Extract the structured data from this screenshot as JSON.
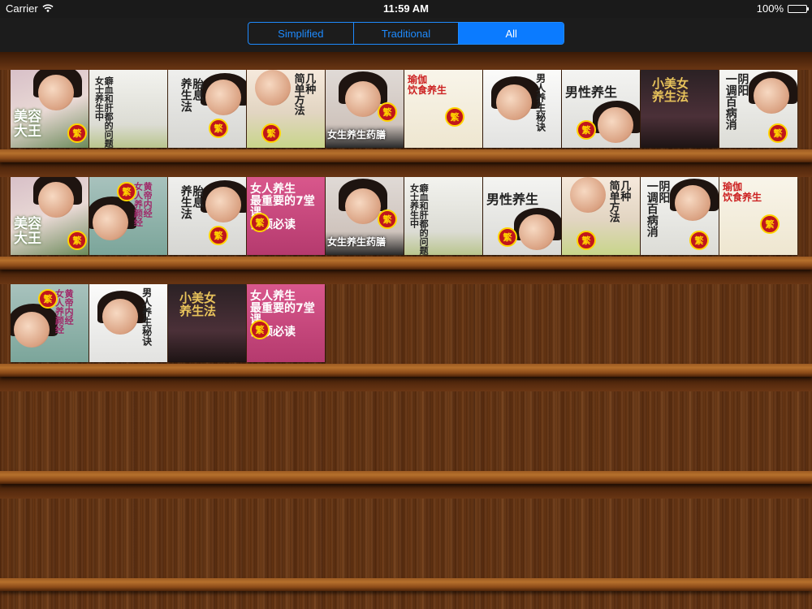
{
  "status_bar": {
    "carrier": "Carrier",
    "time": "11:59 AM",
    "battery": "100%",
    "wifi_icon": "wifi-icon",
    "battery_icon": "battery-icon",
    "battery_level": 1.0
  },
  "segmented": {
    "items": [
      {
        "label": "Simplified",
        "selected": false
      },
      {
        "label": "Traditional",
        "selected": false
      },
      {
        "label": "All",
        "selected": true
      }
    ],
    "accent": "#1e8bff"
  },
  "badge_char": "繁",
  "shelves": [
    {
      "books": [
        {
          "title": "美容大王",
          "cover": "beauty"
        },
        {
          "title": "女士养生中癖血和肝都的问题",
          "cover": "women-qa"
        },
        {
          "title": "胎息养生法",
          "cover": "fetal"
        },
        {
          "title": "几种简单方法",
          "cover": "flower"
        },
        {
          "title": "女生养生药膳",
          "cover": "girl"
        },
        {
          "title": "瑜伽饮食养生",
          "cover": "yoga"
        },
        {
          "title": "男人养生秘诀",
          "cover": "man"
        },
        {
          "title": "男性养生",
          "cover": "male"
        },
        {
          "title": "小美女养生法",
          "cover": "small"
        },
        {
          "title": "阴阳一调百病消",
          "cover": "yinyang"
        }
      ]
    },
    {
      "books": [
        {
          "title": "美容大王",
          "cover": "beauty"
        },
        {
          "title": "黄帝内经女人养颜经",
          "cover": "huangdi"
        },
        {
          "title": "胎息养生法",
          "cover": "fetal"
        },
        {
          "title": "女人养生最重要的7堂课 白领必读",
          "cover": "pink"
        },
        {
          "title": "女生养生药膳",
          "cover": "girl"
        },
        {
          "title": "女士养生中癖血和肝都的问题",
          "cover": "women-qa"
        },
        {
          "title": "男性养生",
          "cover": "male"
        },
        {
          "title": "几种简单方法",
          "cover": "flower"
        },
        {
          "title": "阴阳一调百病消",
          "cover": "yinyang"
        },
        {
          "title": "瑜伽饮食养生",
          "cover": "yoga"
        }
      ]
    },
    {
      "books": [
        {
          "title": "黄帝内经女人养颜经",
          "cover": "huangdi"
        },
        {
          "title": "男人养生秘诀",
          "cover": "man"
        },
        {
          "title": "小美女养生法",
          "cover": "small"
        },
        {
          "title": "女人养生最重要的7堂课 白领必读",
          "cover": "pink"
        }
      ]
    },
    {
      "books": []
    },
    {
      "books": []
    }
  ],
  "cover_text": {
    "beauty": [
      "美容",
      "大王"
    ],
    "women-qa": [
      "癖血和肝都的问题",
      "女士养生中"
    ],
    "fetal": [
      "胎息",
      "养生法"
    ],
    "flower": [
      "几种",
      "简单方法"
    ],
    "girl": [
      "女生养生药膳"
    ],
    "yoga": [
      "瑜伽",
      "饮食养生"
    ],
    "man": [
      "男人养生秘诀"
    ],
    "male": [
      "男性养生"
    ],
    "small": [
      "小美女",
      "养生法"
    ],
    "yinyang": [
      "阴阳",
      "一调百病消"
    ],
    "huangdi": [
      "黄帝内经",
      "女人养颜经"
    ],
    "pink": [
      "女人养生",
      "最重要的7堂课",
      "白领必读"
    ]
  }
}
